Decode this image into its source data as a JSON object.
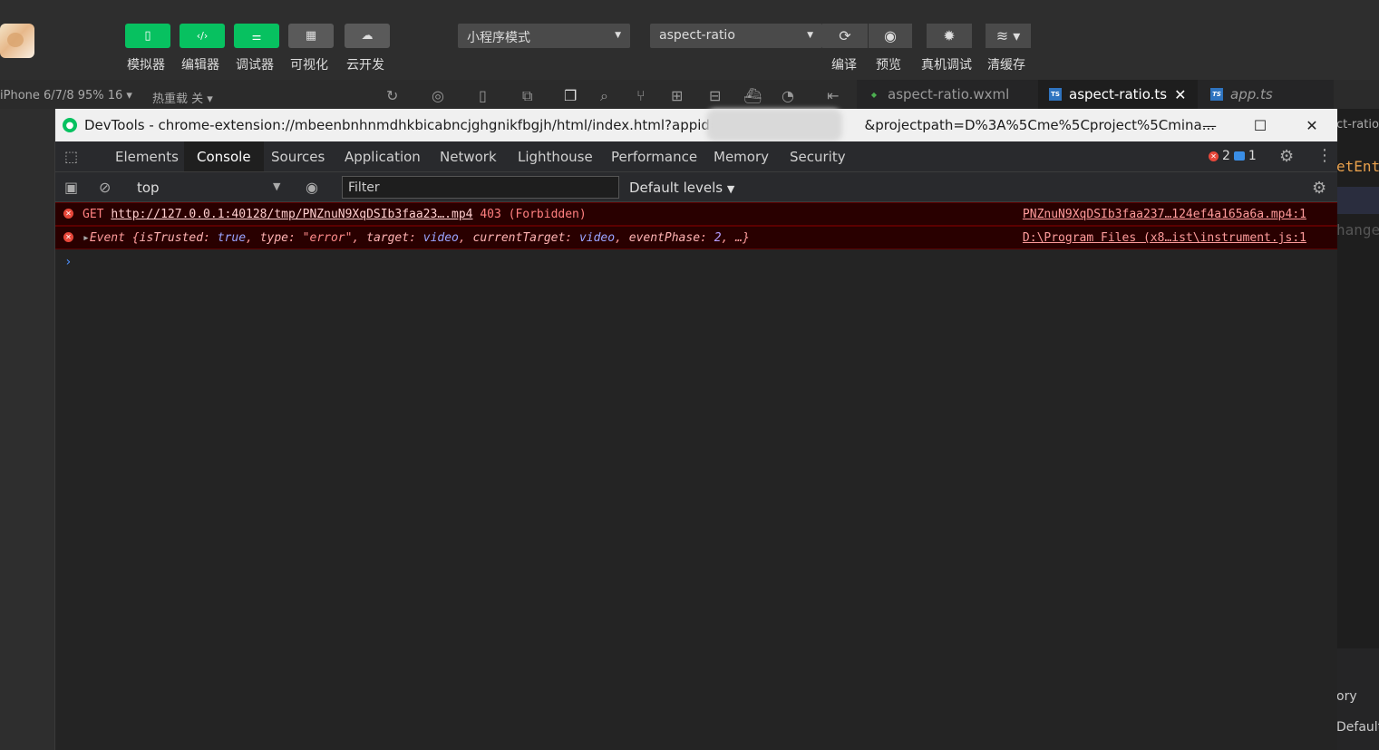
{
  "toolbar": {
    "buttons": [
      {
        "label": "模拟器",
        "icon": "phone-icon"
      },
      {
        "label": "编辑器",
        "icon": "code-icon"
      },
      {
        "label": "调试器",
        "icon": "debug-sliders-icon"
      },
      {
        "label": "可视化",
        "icon": "layout-icon"
      },
      {
        "label": "云开发",
        "icon": "cloud-icon"
      }
    ],
    "mode_select": "小程序模式",
    "compile_select": "aspect-ratio",
    "actions": [
      {
        "label": "编译",
        "icon": "refresh-icon"
      },
      {
        "label": "预览",
        "icon": "eye-icon"
      },
      {
        "label": "真机调试",
        "icon": "bug-icon"
      },
      {
        "label": "清缓存",
        "icon": "layers-icon"
      }
    ]
  },
  "subbar": {
    "device": "iPhone 6/7/8 95% 16 ▾",
    "hot_reload": "热重载 关 ▾"
  },
  "editor_tabs": [
    {
      "label": "aspect-ratio.wxml",
      "type": "wxml",
      "active": false
    },
    {
      "label": "aspect-ratio.ts",
      "type": "TS",
      "active": true
    },
    {
      "label": "app.ts",
      "type": "TS",
      "active": false
    }
  ],
  "right_edge": {
    "line1": "ct-ratio",
    "line2": "etEnt",
    "line3": "hange",
    "line4": "ory",
    "line5": "Default"
  },
  "devtools": {
    "title_left": "DevTools - chrome-extension://mbeenbnhnmdhkbicabncjghgnikfbgjh/html/index.html?appid=",
    "title_right": "&projectpath=D%3A%5Cme%5Cproject%5Cmina...",
    "tabs": [
      "Elements",
      "Console",
      "Sources",
      "Application",
      "Network",
      "Lighthouse",
      "Performance",
      "Memory",
      "Security"
    ],
    "active_tab": "Console",
    "error_count": "2",
    "message_count": "1",
    "context": "top",
    "filter_placeholder": "Filter",
    "levels": "Default levels",
    "messages": [
      {
        "method": "GET",
        "url": "http://127.0.0.1:40128/tmp/PNZnuN9XqDSIb3faa23….mp4",
        "status": "403 (Forbidden)",
        "source": "PNZnuN9XqDSIb3faa237…124ef4a165a6a.mp4:1"
      },
      {
        "prefix": "Event {",
        "k1": "isTrusted",
        "v1": "true",
        "k2": "type",
        "v2": "\"error\"",
        "k3": "target",
        "v3": "video",
        "k4": "currentTarget",
        "v4": "video",
        "k5": "eventPhase",
        "v5": "2",
        "suffix": "…}",
        "source": "D:\\Program Files (x8…ist\\instrument.js:1"
      }
    ],
    "prompt": "›"
  }
}
